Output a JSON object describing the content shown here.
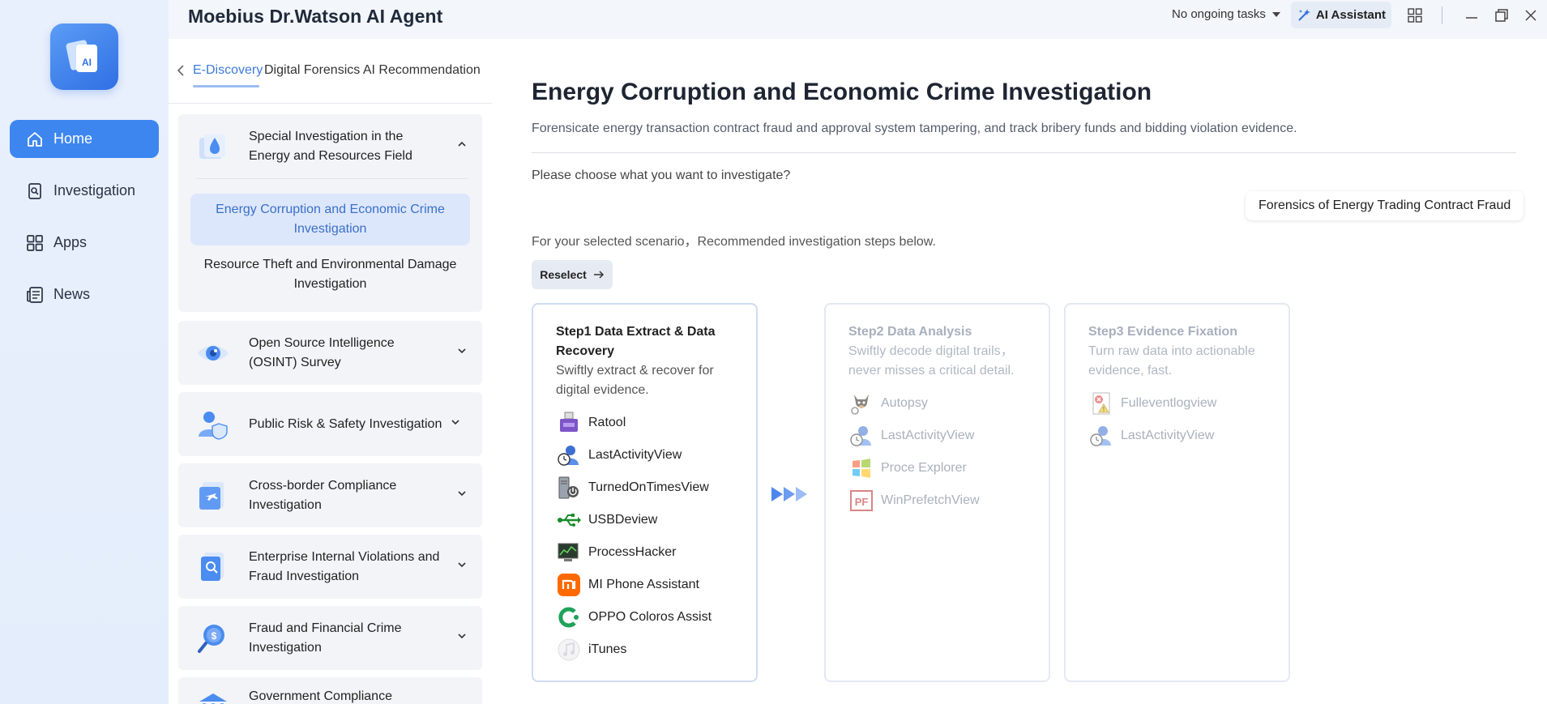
{
  "app": {
    "title": "Moebius Dr.Watson AI Agent"
  },
  "titlebar": {
    "tasks_label": "No ongoing tasks",
    "assistant_label": "AI Assistant"
  },
  "nav": {
    "items": [
      {
        "label": "Home",
        "icon": "home-icon",
        "active": true
      },
      {
        "label": "Investigation",
        "icon": "investigation-icon"
      },
      {
        "label": "Apps",
        "icon": "apps-icon"
      },
      {
        "label": "News",
        "icon": "news-icon"
      }
    ]
  },
  "breadcrumb": {
    "first": "E-Discovery",
    "second": "Digital Forensics AI Recommendation"
  },
  "categories": [
    {
      "title": "Special Investigation in the Energy and Resources Field",
      "expanded": true,
      "subs": [
        "Energy Corruption and Economic Crime Investigation",
        "Resource Theft and Environmental Damage Investigation"
      ]
    },
    {
      "title": "Open Source Intelligence (OSINT) Survey"
    },
    {
      "title": "Public Risk & Safety Investigation"
    },
    {
      "title": "Cross-border Compliance Investigation"
    },
    {
      "title": "Enterprise Internal Violations and Fraud Investigation"
    },
    {
      "title": "Fraud and Financial Crime Investigation"
    },
    {
      "title": "Government Compliance"
    }
  ],
  "main": {
    "title": "Energy Corruption and Economic Crime Investigation",
    "description": "Forensicate energy transaction contract fraud and approval system tampering, and track bribery funds and bidding violation evidence.",
    "prompt": "Please choose what you want to investigate?",
    "selected_chip": "Forensics of Energy Trading Contract Fraud",
    "recommend_text": "For your selected scenario，Recommended investigation steps below.",
    "reselect_label": "Reselect"
  },
  "steps": [
    {
      "title": "Step1 Data Extract & Data Recovery",
      "desc": "Swiftly extract & recover for digital evidence.",
      "tools": [
        "Ratool",
        "LastActivityView",
        "TurnedOnTimesView",
        "USBDeview",
        "ProcessHacker",
        "MI Phone Assistant",
        "OPPO Coloros Assist",
        "iTunes"
      ]
    },
    {
      "title": "Step2 Data Analysis",
      "desc": "Swiftly decode digital trails，never misses a critical detail.",
      "tools": [
        "Autopsy",
        "LastActivityView",
        "Proce Explorer",
        "WinPrefetchView"
      ]
    },
    {
      "title": "Step3 Evidence Fixation",
      "desc": "Turn raw data into actionable evidence, fast.",
      "tools": [
        "Fulleventlogview",
        "LastActivityView"
      ]
    }
  ],
  "colors": {
    "accent": "#3d86f0",
    "nav_bg": "#e7effc",
    "active_sub_bg": "#dde7fb",
    "arrow": "#5b93ee"
  }
}
